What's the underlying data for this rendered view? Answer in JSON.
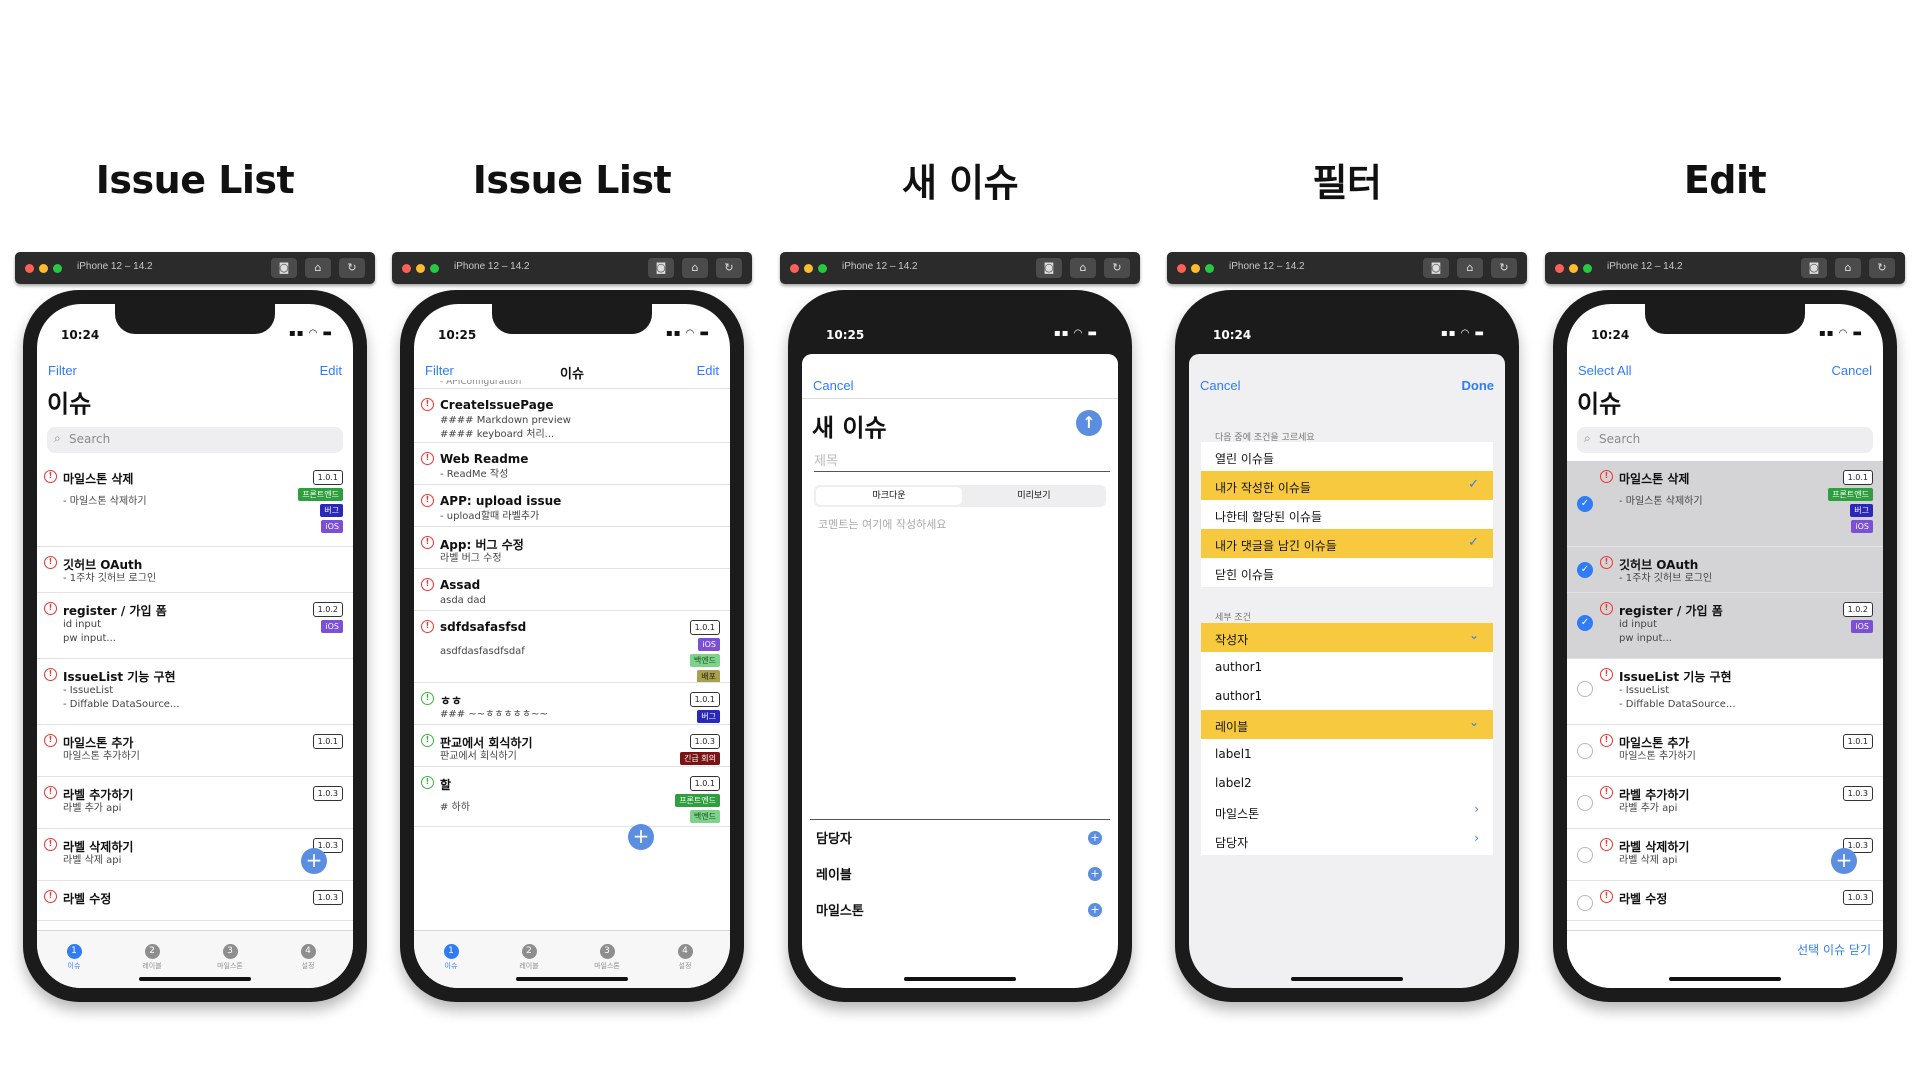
{
  "headings": [
    "Issue List",
    "Issue List",
    "새 이슈",
    "필터",
    "Edit"
  ],
  "device": "iPhone 12 – 14.2",
  "tabs": [
    {
      "n": "1",
      "label": "이슈"
    },
    {
      "n": "2",
      "label": "레이블"
    },
    {
      "n": "3",
      "label": "마일스톤"
    },
    {
      "n": "4",
      "label": "설정"
    }
  ],
  "screen1": {
    "time": "10:24",
    "left": "Filter",
    "right": "Edit",
    "title": "이슈",
    "search": "Search",
    "rows": [
      {
        "title": "마일스톤 삭제",
        "desc": "- 마일스톤 삭제하기"
      },
      {
        "title": "깃허브 OAuth",
        "desc": "- 1주차 깃허브 로그인"
      },
      {
        "title": "register / 가입 폼",
        "desc": "id input\npw input..."
      },
      {
        "title": "IssueList 기능 구현",
        "desc": "- IssueList\n- Diffable DataSource..."
      },
      {
        "title": "마일스톤 추가",
        "desc": "마일스톤 추가하기"
      },
      {
        "title": "라벨 추가하기",
        "desc": "라벨 추가 api"
      },
      {
        "title": "라벨 삭제하기",
        "desc": "라벨 삭제 api"
      },
      {
        "title": "라벨 수정",
        "desc": ""
      }
    ],
    "badges": {
      "r0": [
        "1.0.1",
        "프론트엔드",
        "버그",
        "iOS"
      ],
      "r2": [
        "1.0.2",
        "iOS"
      ],
      "r4": [
        "1.0.1"
      ],
      "r5": [
        "1.0.3"
      ],
      "r6": [
        "1.0.3"
      ],
      "r7": [
        "1.0.3"
      ]
    }
  },
  "screen2": {
    "time": "10:25",
    "left": "Filter",
    "center": "이슈",
    "right": "Edit",
    "cut": "- APIConfiguration",
    "rows": [
      {
        "title": "CreateIssuePage",
        "desc": "#### Markdown preview\n#### keyboard 처리..."
      },
      {
        "title": "Web Readme",
        "desc": "- ReadMe 작성"
      },
      {
        "title": "APP: upload issue",
        "desc": "- upload할때 라벨추가"
      },
      {
        "title": "App: 버그 수정",
        "desc": "라벨 버그 수정"
      },
      {
        "title": "Assad",
        "desc": "asda dad"
      },
      {
        "title": "sdfdsafasfsd",
        "desc": "asdfdasfasdfsdaf"
      },
      {
        "title": "ㅎㅎ",
        "desc": "### ~~ㅎㅎㅎㅎㅎ~~"
      },
      {
        "title": "판교에서 회식하기",
        "desc": "판교에서 회식하기"
      },
      {
        "title": "할",
        "desc": "# 하하"
      }
    ],
    "badges": {
      "r5": [
        "1.0.1",
        "iOS",
        "백엔드",
        "배포"
      ],
      "r6": [
        "1.0.1",
        "버그"
      ],
      "r7": [
        "1.0.3",
        "긴급 회의"
      ],
      "r8": [
        "1.0.1",
        "프론트엔드",
        "백엔드"
      ]
    }
  },
  "screen3": {
    "time": "10:25",
    "cancel": "Cancel",
    "title": "새 이슈",
    "titlePlaceholder": "제목",
    "seg": [
      "마크다운",
      "미리보기"
    ],
    "commentPlaceholder": "코멘트는 여기에 작성하세요",
    "fields": [
      "담당자",
      "레이블",
      "마일스톤"
    ]
  },
  "screen4": {
    "time": "10:24",
    "cancel": "Cancel",
    "done": "Done",
    "section1": "다음 중에 조건을 고르세요",
    "options": [
      "열린 이슈들",
      "내가 작성한 이슈들",
      "나한테 할당된 이슈들",
      "내가 댓글을 남긴 이슈들",
      "닫힌 이슈들"
    ],
    "section2": "세부 조건",
    "details": [
      "작성자",
      "author1",
      "author1",
      "레이블",
      "label1",
      "label2",
      "마일스톤",
      "담당자"
    ]
  },
  "screen5": {
    "time": "10:24",
    "left": "Select All",
    "right": "Cancel",
    "title": "이슈",
    "search": "Search",
    "footer": "선택 이슈 닫기"
  },
  "colors": {
    "accent": "#2f7cf6",
    "highlight": "#f7c93f",
    "closedIcon": "#e33333",
    "openIcon": "#3db13d"
  }
}
